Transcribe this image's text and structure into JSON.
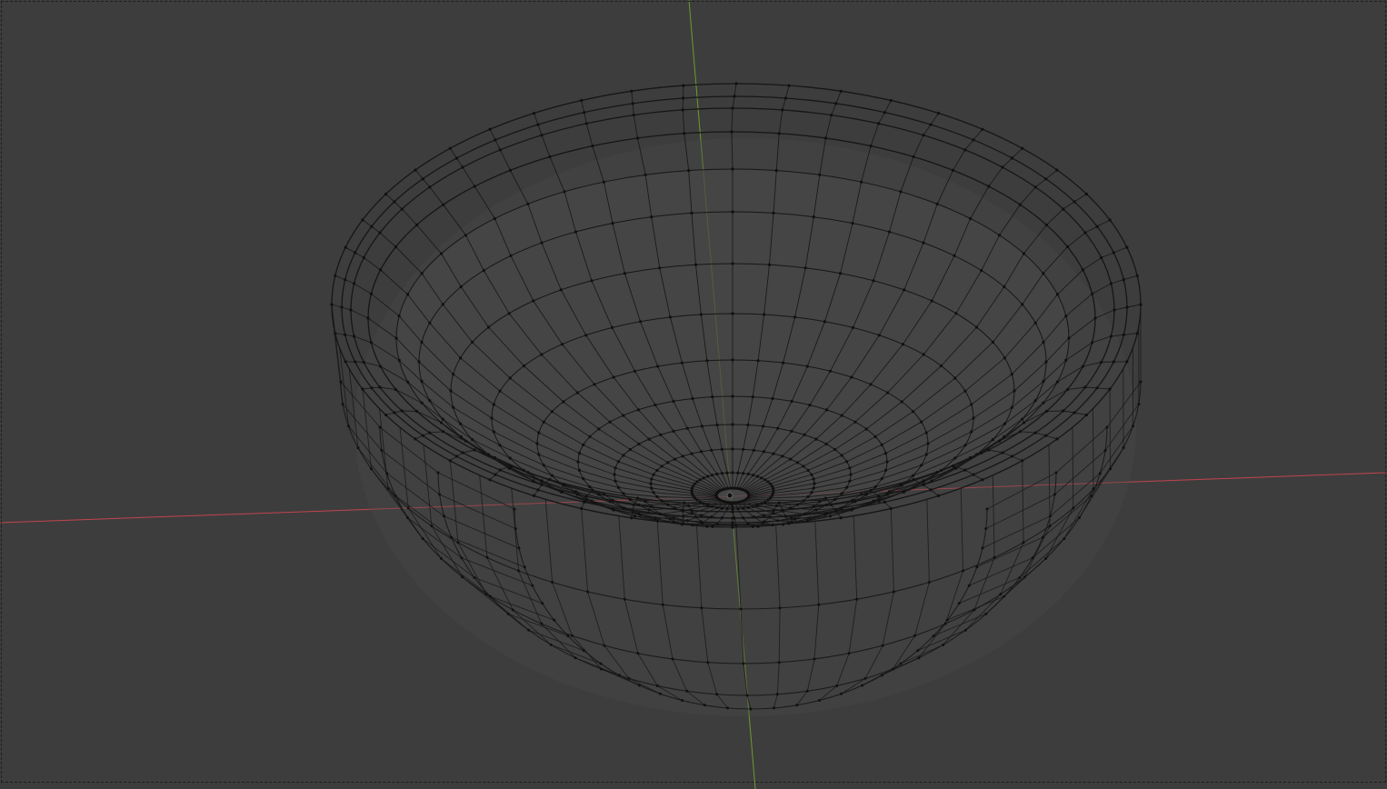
{
  "viewport": {
    "background": "#3d3d3d",
    "frame_style": "dashed",
    "frame_color": "#1f1f1f",
    "shading": "wireframe"
  },
  "axes": {
    "x_color": "#c2444e",
    "y_color": "#6f9a2e"
  },
  "mesh": {
    "object": "bowl",
    "wire_color": "#161616",
    "face_color": "#4a4a4a",
    "vertex_color": "#111111"
  }
}
